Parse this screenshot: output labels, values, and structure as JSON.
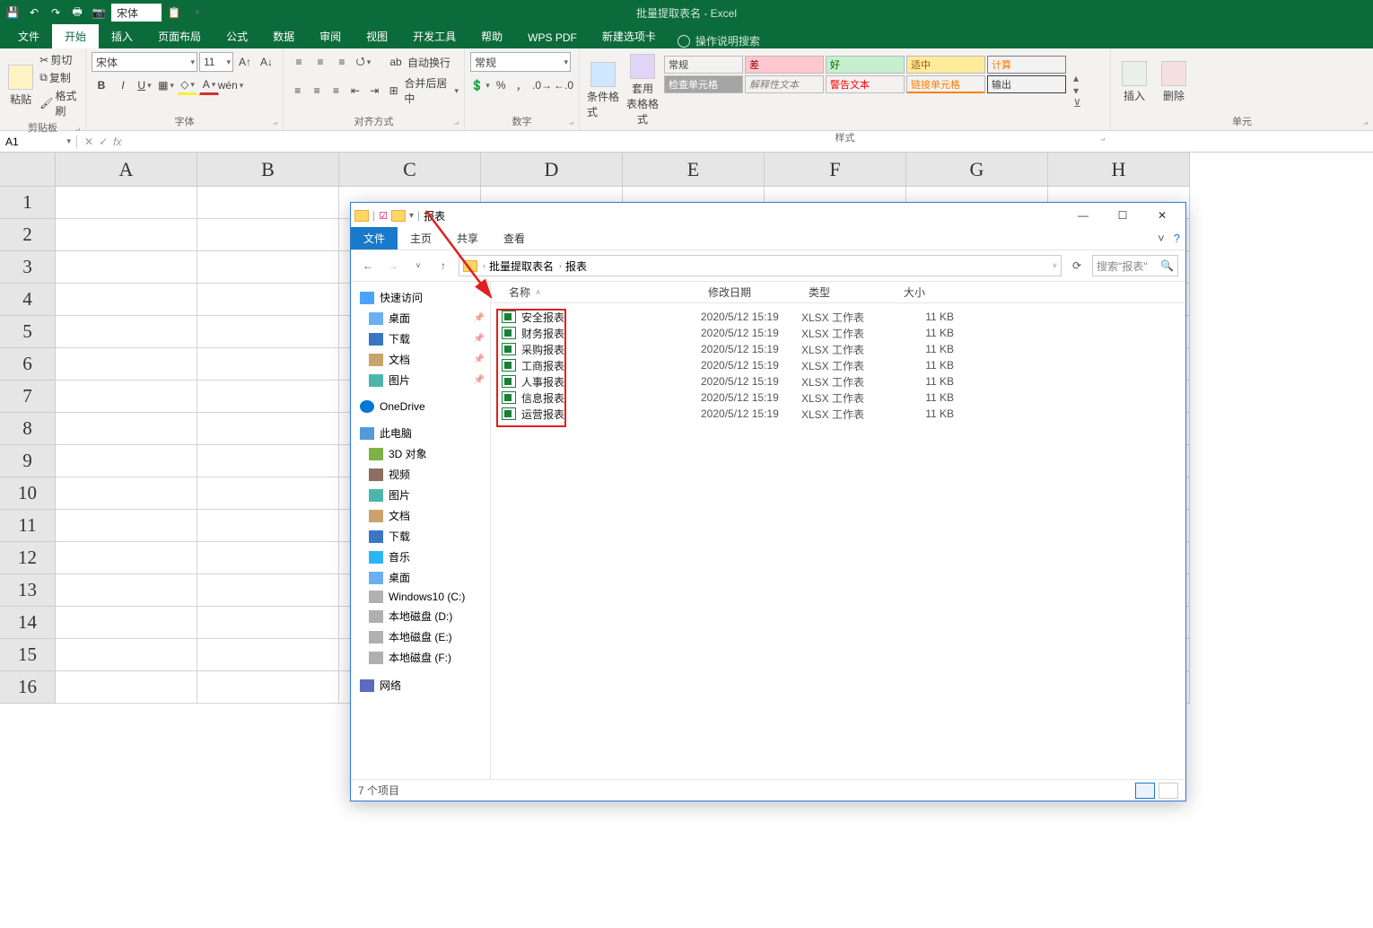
{
  "app": {
    "title": "批量提取表名 - Excel"
  },
  "qat": {
    "font": "宋体"
  },
  "tabs": {
    "file": "文件",
    "home": "开始",
    "insert": "插入",
    "pagelayout": "页面布局",
    "formulas": "公式",
    "data": "数据",
    "review": "审阅",
    "view": "视图",
    "developer": "开发工具",
    "help": "帮助",
    "wpspdf": "WPS PDF",
    "newtab": "新建选项卡",
    "tellme": "操作说明搜索"
  },
  "ribbon": {
    "clipboard": {
      "label": "剪贴板",
      "paste": "粘贴",
      "cut": "剪切",
      "copy": "复制",
      "painter": "格式刷"
    },
    "font": {
      "label": "字体",
      "name": "宋体",
      "size": "11"
    },
    "align": {
      "label": "对齐方式",
      "wrap": "自动换行",
      "merge": "合并后居中"
    },
    "number": {
      "label": "数字",
      "format": "常规"
    },
    "styles": {
      "label": "样式",
      "condfmt": "条件格式",
      "tablefmt": "套用\n表格格式",
      "cells": {
        "normal": "常规",
        "bad": "差",
        "good": "好",
        "neutral": "适中",
        "calc": "计算",
        "check": "检查单元格",
        "explain": "解释性文本",
        "warn": "警告文本",
        "link": "链接单元格",
        "output": "输出"
      }
    },
    "cells_grp": {
      "label": "单元",
      "insert": "插入",
      "delete": "删除"
    }
  },
  "formula": {
    "namebox": "A1"
  },
  "cols": [
    "A",
    "B",
    "C",
    "D",
    "E",
    "F",
    "G",
    "H"
  ],
  "rows": [
    "1",
    "2",
    "3",
    "4",
    "5",
    "6",
    "7",
    "8",
    "9",
    "10",
    "11",
    "12",
    "13",
    "14",
    "15",
    "16"
  ],
  "explorer": {
    "title": "报表",
    "tabs": {
      "file": "文件",
      "home": "主页",
      "share": "共享",
      "view": "查看"
    },
    "breadcrumb": [
      "批量提取表名",
      "报表"
    ],
    "search_placeholder": "搜索\"报表\"",
    "nav": {
      "quick": "快速访问",
      "desktop": "桌面",
      "downloads": "下载",
      "documents": "文档",
      "pictures": "图片",
      "onedrive": "OneDrive",
      "thispc": "此电脑",
      "objects3d": "3D 对象",
      "videos": "视频",
      "pictures2": "图片",
      "documents2": "文档",
      "downloads2": "下载",
      "music": "音乐",
      "desktop2": "桌面",
      "win10": "Windows10 (C:)",
      "d": "本地磁盘 (D:)",
      "e": "本地磁盘 (E:)",
      "f": "本地磁盘 (F:)",
      "network": "网络"
    },
    "columns": {
      "name": "名称",
      "date": "修改日期",
      "type": "类型",
      "size": "大小"
    },
    "files": [
      {
        "name": "安全报表",
        "date": "2020/5/12 15:19",
        "type": "XLSX 工作表",
        "size": "11 KB"
      },
      {
        "name": "财务报表",
        "date": "2020/5/12 15:19",
        "type": "XLSX 工作表",
        "size": "11 KB"
      },
      {
        "name": "采购报表",
        "date": "2020/5/12 15:19",
        "type": "XLSX 工作表",
        "size": "11 KB"
      },
      {
        "name": "工商报表",
        "date": "2020/5/12 15:19",
        "type": "XLSX 工作表",
        "size": "11 KB"
      },
      {
        "name": "人事报表",
        "date": "2020/5/12 15:19",
        "type": "XLSX 工作表",
        "size": "11 KB"
      },
      {
        "name": "信息报表",
        "date": "2020/5/12 15:19",
        "type": "XLSX 工作表",
        "size": "11 KB"
      },
      {
        "name": "运营报表",
        "date": "2020/5/12 15:19",
        "type": "XLSX 工作表",
        "size": "11 KB"
      }
    ],
    "status": "7 个项目"
  }
}
